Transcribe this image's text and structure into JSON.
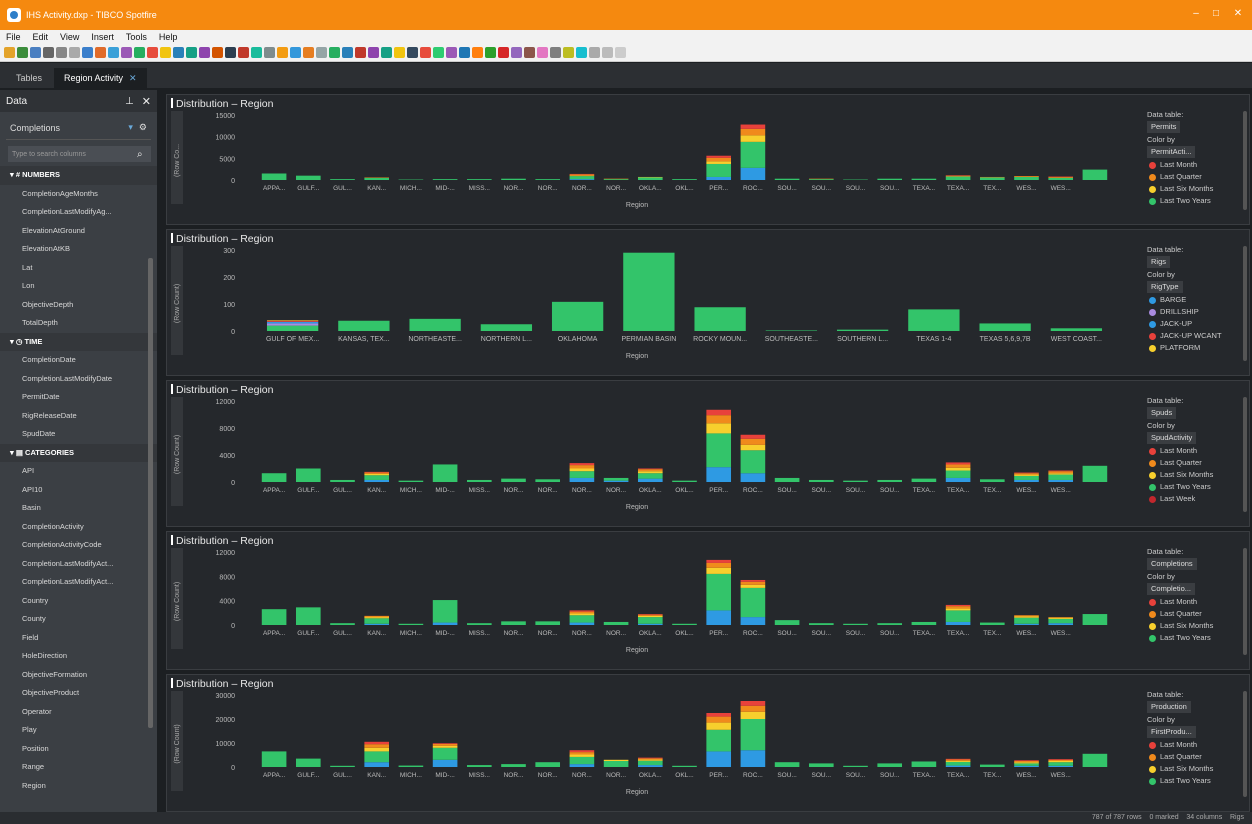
{
  "window": {
    "title": "IHS Activity.dxp - TIBCO Spotfire"
  },
  "menu": [
    "File",
    "Edit",
    "View",
    "Insert",
    "Tools",
    "Help"
  ],
  "tabs": {
    "tables": "Tables",
    "active": "Region Activity"
  },
  "data_panel": {
    "title": "Data",
    "table": "Completions",
    "search_placeholder": "Type to search columns",
    "groups": [
      {
        "name": "NUMBERS",
        "items": [
          "CompletionAgeMonths",
          "CompletionLastModifyAg...",
          "ElevationAtGround",
          "ElevationAtKB",
          "Lat",
          "Lon",
          "ObjectiveDepth",
          "TotalDepth"
        ]
      },
      {
        "name": "TIME",
        "items": [
          "CompletionDate",
          "CompletionLastModifyDate",
          "PermitDate",
          "RigReleaseDate",
          "SpudDate"
        ]
      },
      {
        "name": "CATEGORIES",
        "items": [
          "API",
          "API10",
          "Basin",
          "CompletionActivity",
          "CompletionActivityCode",
          "CompletionLastModifyAct...",
          "CompletionLastModifyAct...",
          "Country",
          "County",
          "Field",
          "HoleDirection",
          "ObjectiveFormation",
          "ObjectiveProduct",
          "Operator",
          "Play",
          "Position",
          "Range",
          "Region"
        ]
      }
    ]
  },
  "colors": {
    "red": "#e8413b",
    "orange": "#f08a1c",
    "yellow": "#f7cf2d",
    "green": "#33c46a",
    "blue": "#2e9ae3",
    "purple": "#a98be0",
    "darkred": "#c2272d"
  },
  "visualizations": [
    {
      "title": "Distribution – Region",
      "ylabel": "(Row Co...",
      "yticks": [
        "15000",
        "10000",
        "5000",
        "0"
      ],
      "ymax": 15000,
      "x_labels": [
        "APPA...",
        "GULF...",
        "GUL...",
        "KAN...",
        "MICH...",
        "MID-...",
        "MISS...",
        "NOR...",
        "NOR...",
        "NOR...",
        "NOR...",
        "OKLA...",
        "OKL...",
        "PER...",
        "ROC...",
        "SOU...",
        "SOU...",
        "SOU...",
        "SOU...",
        "TEXA...",
        "TEXA...",
        "TEX...",
        "WES...",
        "WES..."
      ],
      "xaxis": "Region",
      "legend": {
        "data_table_label": "Data table:",
        "data_table": "Permits",
        "color_by_label": "Color by",
        "color_by": "PermitActi...",
        "items": [
          [
            "Last Month",
            "red"
          ],
          [
            "Last Quarter",
            "orange"
          ],
          [
            "Last Six Months",
            "yellow"
          ],
          [
            "Last Two Years",
            "green"
          ]
        ]
      },
      "series_colors": [
        "blue",
        "green",
        "yellow",
        "orange",
        "red"
      ],
      "chart_values": [
        [
          0,
          1500,
          0,
          0,
          0
        ],
        [
          0,
          1000,
          0,
          0,
          0
        ],
        [
          0,
          200,
          0,
          0,
          0
        ],
        [
          0,
          500,
          0,
          100,
          0
        ],
        [
          0,
          100,
          0,
          0,
          0
        ],
        [
          0,
          200,
          0,
          0,
          0
        ],
        [
          0,
          200,
          0,
          0,
          0
        ],
        [
          0,
          300,
          0,
          0,
          0
        ],
        [
          0,
          200,
          0,
          0,
          0
        ],
        [
          200,
          700,
          100,
          300,
          100
        ],
        [
          0,
          200,
          0,
          100,
          0
        ],
        [
          0,
          600,
          100,
          0,
          0
        ],
        [
          0,
          200,
          0,
          0,
          0
        ],
        [
          700,
          3000,
          600,
          800,
          500
        ],
        [
          2800,
          6000,
          1500,
          1500,
          1000
        ],
        [
          0,
          300,
          0,
          0,
          0
        ],
        [
          0,
          200,
          0,
          100,
          0
        ],
        [
          0,
          100,
          0,
          0,
          0
        ],
        [
          0,
          300,
          0,
          0,
          0
        ],
        [
          0,
          300,
          0,
          0,
          0
        ],
        [
          0,
          800,
          0,
          200,
          100
        ],
        [
          0,
          600,
          0,
          100,
          0
        ],
        [
          0,
          700,
          0,
          200,
          0
        ],
        [
          0,
          500,
          0,
          200,
          100
        ],
        [
          0,
          2400,
          0,
          0,
          0
        ]
      ]
    },
    {
      "title": "Distribution – Region",
      "ylabel": "(Row Count)",
      "yticks": [
        "300",
        "200",
        "100",
        "0"
      ],
      "ymax": 300,
      "x_labels": [
        "GULF OF MEX...",
        "KANSAS, TEX...",
        "NORTHEASTE...",
        "NORTHERN L...",
        "OKLAHOMA",
        "PERMIAN BASIN",
        "ROCKY MOUN...",
        "SOUTHEASTE...",
        "SOUTHERN L...",
        "TEXAS 1-4",
        "TEXAS 5,6,9,7B",
        "WEST COAST..."
      ],
      "xaxis": "Region",
      "legend": {
        "data_table_label": "Data table:",
        "data_table": "Rigs",
        "color_by_label": "Color by",
        "color_by": "RigType",
        "items": [
          [
            "BARGE",
            "blue"
          ],
          [
            "DRILLSHIP",
            "purple"
          ],
          [
            "JACK-UP",
            "blue"
          ],
          [
            "JACK-UP WCANT",
            "red"
          ],
          [
            "PLATFORM",
            "yellow"
          ]
        ]
      },
      "series_colors": [
        "green",
        "purple",
        "blue",
        "red",
        "yellow"
      ],
      "chart_values": [
        [
          20,
          8,
          6,
          4,
          2
        ],
        [
          38,
          0,
          0,
          0,
          0
        ],
        [
          45,
          0,
          0,
          0,
          0
        ],
        [
          25,
          0,
          0,
          0,
          0
        ],
        [
          108,
          0,
          0,
          0,
          0
        ],
        [
          290,
          0,
          0,
          0,
          0
        ],
        [
          88,
          0,
          0,
          0,
          0
        ],
        [
          2,
          0,
          0,
          0,
          0
        ],
        [
          5,
          0,
          0,
          0,
          0
        ],
        [
          80,
          0,
          0,
          0,
          0
        ],
        [
          28,
          0,
          0,
          0,
          0
        ],
        [
          10,
          0,
          0,
          0,
          0
        ]
      ]
    },
    {
      "title": "Distribution – Region",
      "ylabel": "(Row Count)",
      "yticks": [
        "12000",
        "8000",
        "4000",
        "0"
      ],
      "ymax": 12000,
      "x_labels": [
        "APPA...",
        "GULF...",
        "GUL...",
        "KAN...",
        "MICH...",
        "MID-...",
        "MISS...",
        "NOR...",
        "NOR...",
        "NOR...",
        "NOR...",
        "OKLA...",
        "OKL...",
        "PER...",
        "ROC...",
        "SOU...",
        "SOU...",
        "SOU...",
        "SOU...",
        "TEXA...",
        "TEXA...",
        "TEX...",
        "WES...",
        "WES..."
      ],
      "xaxis": "Region",
      "legend": {
        "data_table_label": "Data table:",
        "data_table": "Spuds",
        "color_by_label": "Color by",
        "color_by": "SpudActivity",
        "items": [
          [
            "Last Month",
            "red"
          ],
          [
            "Last Quarter",
            "orange"
          ],
          [
            "Last Six Months",
            "yellow"
          ],
          [
            "Last Two Years",
            "green"
          ],
          [
            "Last Week",
            "darkred"
          ]
        ]
      },
      "series_colors": [
        "blue",
        "green",
        "yellow",
        "orange",
        "red"
      ],
      "chart_values": [
        [
          0,
          1300,
          0,
          0,
          0
        ],
        [
          0,
          2000,
          0,
          0,
          0
        ],
        [
          0,
          300,
          0,
          0,
          0
        ],
        [
          300,
          700,
          200,
          200,
          100
        ],
        [
          0,
          200,
          0,
          0,
          0
        ],
        [
          0,
          2600,
          0,
          0,
          0
        ],
        [
          0,
          300,
          0,
          0,
          0
        ],
        [
          0,
          500,
          0,
          0,
          0
        ],
        [
          0,
          400,
          0,
          0,
          0
        ],
        [
          600,
          1000,
          400,
          500,
          300
        ],
        [
          200,
          400,
          0,
          0,
          0
        ],
        [
          500,
          800,
          300,
          300,
          100
        ],
        [
          0,
          200,
          0,
          0,
          0
        ],
        [
          2200,
          5000,
          1500,
          1200,
          800
        ],
        [
          1300,
          3400,
          800,
          900,
          600
        ],
        [
          0,
          600,
          0,
          0,
          0
        ],
        [
          0,
          300,
          0,
          0,
          0
        ],
        [
          0,
          200,
          0,
          0,
          0
        ],
        [
          0,
          300,
          0,
          0,
          0
        ],
        [
          0,
          500,
          0,
          0,
          0
        ],
        [
          600,
          1100,
          400,
          500,
          300
        ],
        [
          0,
          400,
          0,
          0,
          0
        ],
        [
          300,
          600,
          200,
          200,
          100
        ],
        [
          300,
          800,
          200,
          300,
          100
        ],
        [
          0,
          2400,
          0,
          0,
          0
        ]
      ]
    },
    {
      "title": "Distribution – Region",
      "ylabel": "(Row Count)",
      "yticks": [
        "12000",
        "8000",
        "4000",
        "0"
      ],
      "ymax": 12000,
      "x_labels": [
        "APPA...",
        "GULF...",
        "GUL...",
        "KAN...",
        "MICH...",
        "MID-...",
        "MISS...",
        "NOR...",
        "NOR...",
        "NOR...",
        "NOR...",
        "OKLA...",
        "OKL...",
        "PER...",
        "ROC...",
        "SOU...",
        "SOU...",
        "SOU...",
        "SOU...",
        "TEXA...",
        "TEXA...",
        "TEX...",
        "WES...",
        "WES..."
      ],
      "xaxis": "Region",
      "legend": {
        "data_table_label": "Data table:",
        "data_table": "Completions",
        "color_by_label": "Color by",
        "color_by": "Completio...",
        "items": [
          [
            "Last Month",
            "red"
          ],
          [
            "Last Quarter",
            "orange"
          ],
          [
            "Last Six Months",
            "yellow"
          ],
          [
            "Last Two Years",
            "green"
          ]
        ]
      },
      "series_colors": [
        "blue",
        "green",
        "yellow",
        "orange",
        "red"
      ],
      "chart_values": [
        [
          0,
          2600,
          0,
          0,
          0
        ],
        [
          0,
          2900,
          0,
          0,
          0
        ],
        [
          0,
          300,
          0,
          0,
          0
        ],
        [
          200,
          900,
          200,
          200,
          0
        ],
        [
          0,
          200,
          0,
          0,
          0
        ],
        [
          400,
          3700,
          0,
          0,
          0
        ],
        [
          0,
          300,
          0,
          0,
          0
        ],
        [
          0,
          600,
          0,
          0,
          0
        ],
        [
          0,
          600,
          0,
          0,
          0
        ],
        [
          400,
          1200,
          300,
          300,
          200
        ],
        [
          0,
          500,
          0,
          0,
          0
        ],
        [
          200,
          1100,
          200,
          200,
          100
        ],
        [
          0,
          200,
          0,
          0,
          0
        ],
        [
          2400,
          6000,
          1000,
          800,
          500
        ],
        [
          1300,
          4800,
          500,
          500,
          300
        ],
        [
          0,
          800,
          0,
          0,
          0
        ],
        [
          0,
          300,
          0,
          0,
          0
        ],
        [
          0,
          200,
          0,
          0,
          0
        ],
        [
          0,
          300,
          0,
          0,
          0
        ],
        [
          0,
          500,
          0,
          0,
          0
        ],
        [
          500,
          1900,
          300,
          400,
          200
        ],
        [
          0,
          400,
          0,
          0,
          0
        ],
        [
          200,
          1000,
          200,
          200,
          0
        ],
        [
          300,
          700,
          200,
          100,
          0
        ],
        [
          0,
          1800,
          0,
          0,
          0
        ]
      ]
    },
    {
      "title": "Distribution – Region",
      "ylabel": "(Row Count)",
      "yticks": [
        "30000",
        "20000",
        "10000",
        "0"
      ],
      "ymax": 30000,
      "x_labels": [
        "APPA...",
        "GULF...",
        "GUL...",
        "KAN...",
        "MICH...",
        "MID-...",
        "MISS...",
        "NOR...",
        "NOR...",
        "NOR...",
        "NOR...",
        "OKLA...",
        "OKL...",
        "PER...",
        "ROC...",
        "SOU...",
        "SOU...",
        "SOU...",
        "SOU...",
        "TEXA...",
        "TEXA...",
        "TEX...",
        "WES...",
        "WES..."
      ],
      "xaxis": "Region",
      "legend": {
        "data_table_label": "Data table:",
        "data_table": "Production",
        "color_by_label": "Color by",
        "color_by": "FirstProdu...",
        "items": [
          [
            "Last Month",
            "red"
          ],
          [
            "Last Quarter",
            "orange"
          ],
          [
            "Last Six Months",
            "yellow"
          ],
          [
            "Last Two Years",
            "green"
          ]
        ]
      },
      "series_colors": [
        "blue",
        "green",
        "yellow",
        "orange",
        "red"
      ],
      "chart_values": [
        [
          0,
          6500,
          0,
          0,
          0
        ],
        [
          0,
          3500,
          0,
          0,
          0
        ],
        [
          0,
          500,
          0,
          0,
          0
        ],
        [
          2000,
          4500,
          1500,
          1500,
          1000
        ],
        [
          0,
          600,
          0,
          0,
          0
        ],
        [
          3000,
          5000,
          800,
          800,
          300
        ],
        [
          0,
          800,
          0,
          0,
          0
        ],
        [
          0,
          1200,
          0,
          0,
          0
        ],
        [
          0,
          2000,
          0,
          0,
          0
        ],
        [
          1200,
          3000,
          1000,
          1000,
          800
        ],
        [
          0,
          2500,
          500,
          0,
          0
        ],
        [
          800,
          1800,
          500,
          500,
          300
        ],
        [
          0,
          500,
          0,
          0,
          0
        ],
        [
          6500,
          9000,
          3000,
          2500,
          1500
        ],
        [
          7000,
          13000,
          3000,
          2500,
          2000
        ],
        [
          0,
          2000,
          0,
          0,
          0
        ],
        [
          0,
          1500,
          0,
          0,
          0
        ],
        [
          0,
          500,
          0,
          0,
          0
        ],
        [
          0,
          1500,
          0,
          0,
          0
        ],
        [
          0,
          2300,
          0,
          0,
          0
        ],
        [
          600,
          1500,
          500,
          500,
          300
        ],
        [
          0,
          1000,
          0,
          0,
          0
        ],
        [
          500,
          1000,
          500,
          500,
          300
        ],
        [
          500,
          1500,
          500,
          500,
          300
        ],
        [
          0,
          5500,
          0,
          0,
          0
        ]
      ]
    }
  ],
  "status": {
    "rows": "787 of 787 rows",
    "marked": "0 marked",
    "columns": "34 columns",
    "table": "Rigs"
  }
}
